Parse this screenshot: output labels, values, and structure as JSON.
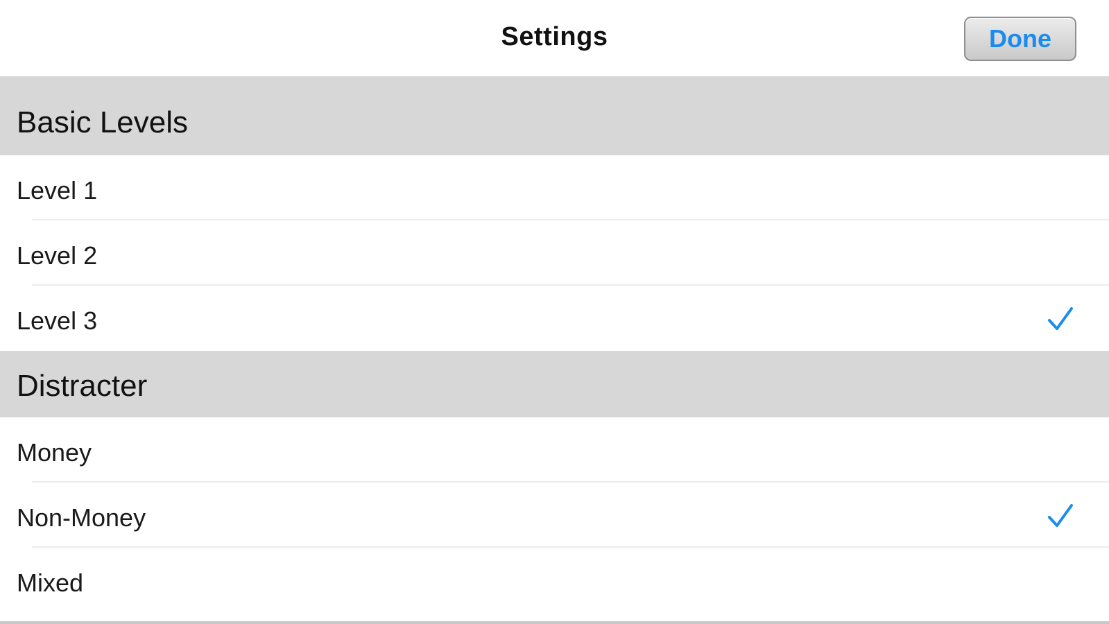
{
  "navbar": {
    "title": "Settings",
    "done_label": "Done"
  },
  "sections": [
    {
      "header": "Basic Levels",
      "rows": [
        {
          "label": "Level 1",
          "checked": false
        },
        {
          "label": "Level 2",
          "checked": false
        },
        {
          "label": "Level 3",
          "checked": true
        }
      ]
    },
    {
      "header": "Distracter",
      "rows": [
        {
          "label": "Money",
          "checked": false
        },
        {
          "label": "Non-Money",
          "checked": true
        },
        {
          "label": "Mixed",
          "checked": false
        }
      ]
    }
  ],
  "colors": {
    "accent": "#1a8cf0",
    "section_bg": "#d7d7d7"
  }
}
